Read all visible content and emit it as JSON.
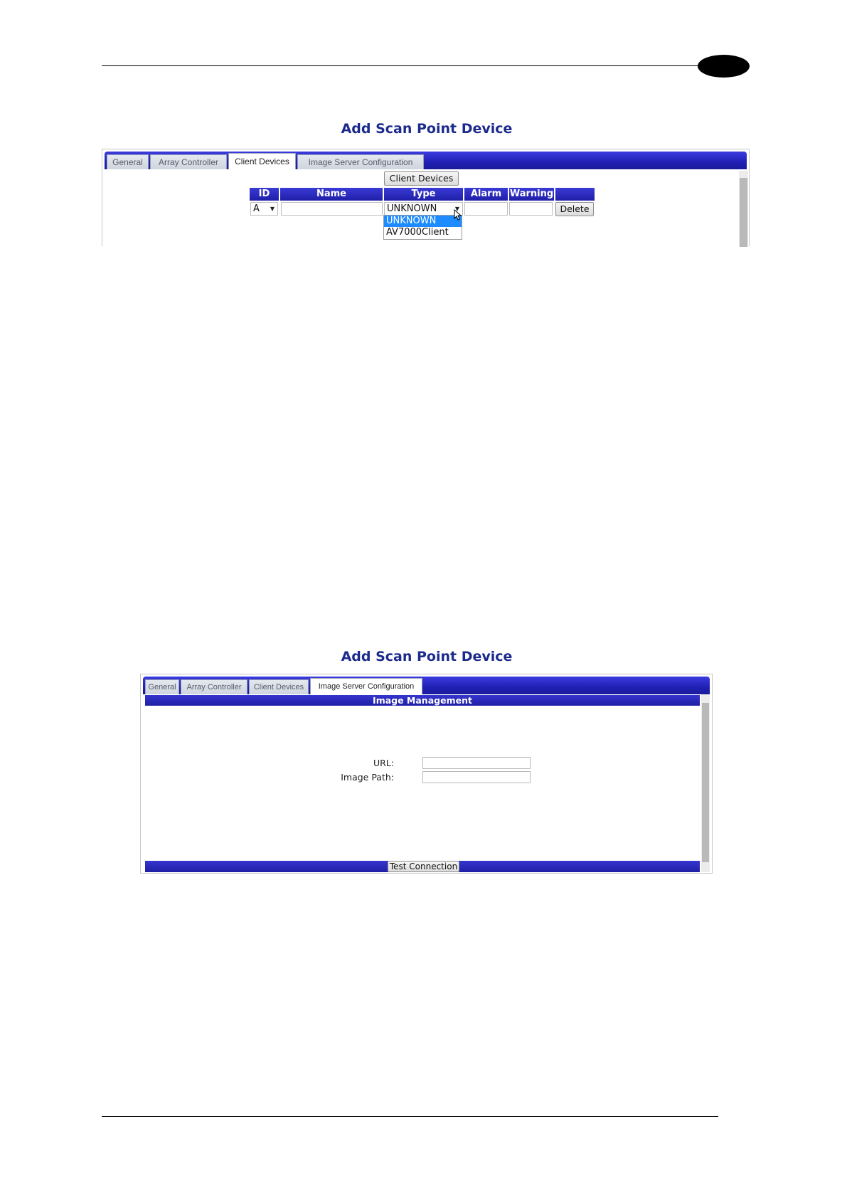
{
  "figure1": {
    "title": "Add Scan Point Device",
    "tabs": [
      "General",
      "Array Controller",
      "Client Devices",
      "Image Server Configuration"
    ],
    "active_tab": "Client Devices",
    "client_devices_button": "Client Devices",
    "columns": [
      "ID",
      "Name",
      "Type",
      "Alarm",
      "Warning",
      ""
    ],
    "row": {
      "id": "A",
      "name": "",
      "type": "UNKNOWN",
      "alarm": "",
      "warning": "",
      "delete_label": "Delete"
    },
    "type_options": [
      "UNKNOWN",
      "AV7000Client"
    ],
    "type_selected_option": "UNKNOWN"
  },
  "figure2": {
    "title": "Add Scan Point Device",
    "tabs": [
      "General",
      "Array Controller",
      "Client Devices",
      "Image Server Configuration"
    ],
    "active_tab": "Image Server Configuration",
    "section_title": "Image Management",
    "url_label": "URL:",
    "url_value": "",
    "image_path_label": "Image Path:",
    "image_path_value": "",
    "test_connection_label": "Test Connection"
  },
  "colors": {
    "title_blue": "#1c2a8c",
    "bar_blue": "#2020b4",
    "selected_option": "#1e8bff"
  }
}
